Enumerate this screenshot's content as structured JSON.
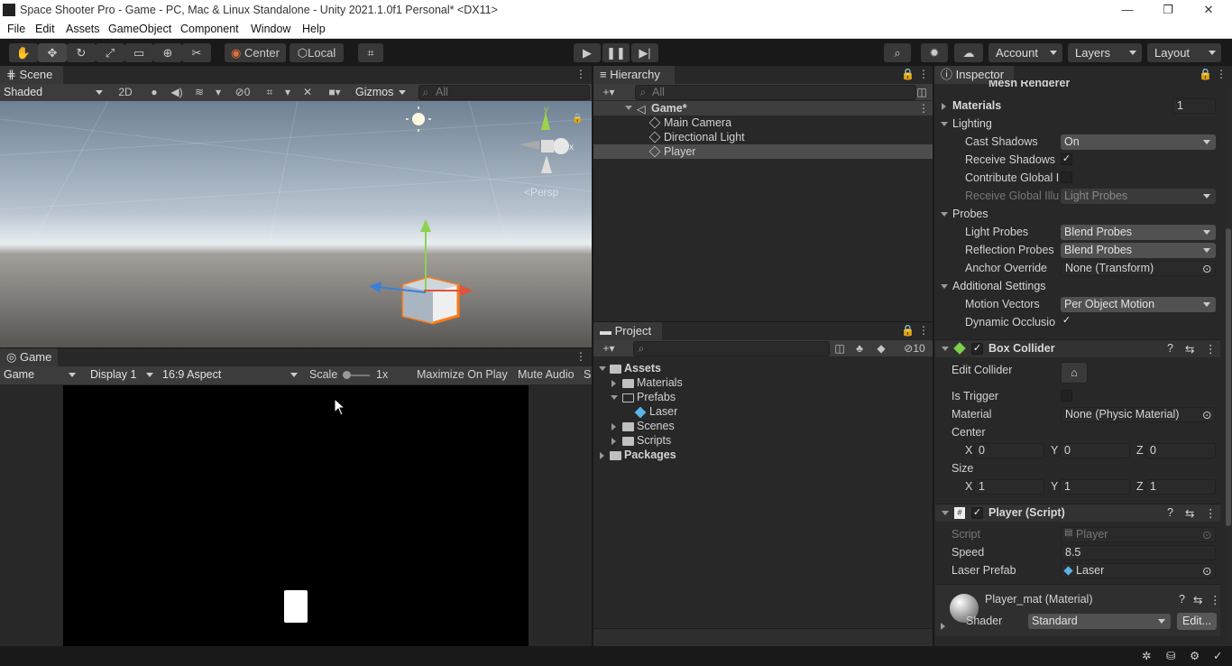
{
  "window": {
    "title": "Space Shooter Pro - Game - PC, Mac & Linux Standalone - Unity 2021.1.0f1 Personal* <DX11>",
    "minimize": "—",
    "maximize": "❐",
    "close": "✕"
  },
  "menu": [
    "File",
    "Edit",
    "Assets",
    "GameObject",
    "Component",
    "Window",
    "Help"
  ],
  "toolbar": {
    "pivot": "Center",
    "space": "Local",
    "account": "Account",
    "layers": "Layers",
    "layout": "Layout"
  },
  "scene": {
    "tab": "Scene",
    "shading": "Shaded",
    "mode2d": "2D",
    "hidden_count": "0",
    "gizmos": "Gizmos",
    "search_placeholder": "All",
    "persp": "<Persp",
    "axis_x": "x",
    "axis_y": "y"
  },
  "game": {
    "tab": "Game",
    "view": "Game",
    "display": "Display 1",
    "aspect": "16:9 Aspect",
    "scale_label": "Scale",
    "scale_value": "1x",
    "maximize": "Maximize On Play",
    "mute": "Mute Audio",
    "cut": "S"
  },
  "hierarchy": {
    "tab": "Hierarchy",
    "search_placeholder": "All",
    "scene_name": "Game*",
    "items": [
      "Main Camera",
      "Directional Light",
      "Player"
    ]
  },
  "project": {
    "tab": "Project",
    "hidden_count": "10",
    "assets": "Assets",
    "folders": [
      "Materials",
      "Prefabs",
      "Scenes",
      "Scripts"
    ],
    "prefab_item": "Laser",
    "packages": "Packages"
  },
  "inspector": {
    "tab": "Inspector",
    "mesh_renderer": "Mesh Renderer",
    "materials_label": "Materials",
    "materials_count": "1",
    "lighting": "Lighting",
    "cast_shadows_label": "Cast Shadows",
    "cast_shadows": "On",
    "receive_shadows": "Receive Shadows",
    "contribute_gi": "Contribute Global I",
    "receive_gi_label": "Receive Global Illu",
    "receive_gi": "Light Probes",
    "probes": "Probes",
    "light_probes_label": "Light Probes",
    "light_probes": "Blend Probes",
    "reflection_probes_label": "Reflection Probes",
    "reflection_probes": "Blend Probes",
    "anchor_label": "Anchor Override",
    "anchor": "None (Transform)",
    "additional": "Additional Settings",
    "motion_label": "Motion Vectors",
    "motion": "Per Object Motion",
    "dynamic_occlusion": "Dynamic Occlusio",
    "box_collider": "Box Collider",
    "edit_collider": "Edit Collider",
    "is_trigger": "Is Trigger",
    "material_label": "Material",
    "material": "None (Physic Material)",
    "center_label": "Center",
    "center": {
      "x": "0",
      "y": "0",
      "z": "0"
    },
    "size_label": "Size",
    "size": {
      "x": "1",
      "y": "1",
      "z": "1"
    },
    "axis": {
      "x": "X",
      "y": "Y",
      "z": "Z"
    },
    "player_script": "Player (Script)",
    "script_label": "Script",
    "script": "Player",
    "speed_label": "Speed",
    "speed": "8.5",
    "laser_label": "Laser Prefab",
    "laser": "Laser",
    "material_asset": "Player_mat (Material)",
    "shader_label": "Shader",
    "shader": "Standard",
    "edit_button": "Edit..."
  },
  "colors": {
    "accent": "#3a79bb",
    "selection": "#2c5d87",
    "panel": "#282828",
    "strip": "#3c3c3c"
  }
}
